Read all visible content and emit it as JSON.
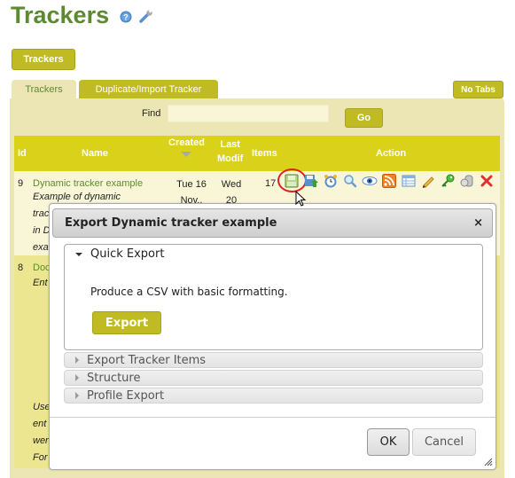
{
  "page": {
    "title": "Trackers",
    "help_icon": "help-icon",
    "admin_icon": "wrench-icon"
  },
  "toolbar": {
    "trackers_button": "Trackers",
    "no_tabs_button": "No Tabs"
  },
  "tabs": [
    {
      "label": "Trackers",
      "active": true
    },
    {
      "label": "Duplicate/Import Tracker",
      "active": false
    }
  ],
  "find": {
    "label": "Find",
    "value": "",
    "go_label": "Go"
  },
  "table": {
    "columns": [
      "Id",
      "Name",
      "Created",
      "Last Modif",
      "Items",
      "Action"
    ],
    "created_col": {
      "line1": "Created"
    },
    "lastmodif_col": {
      "line1": "Last",
      "line2": "Modif"
    },
    "rows": [
      {
        "id": "9",
        "name": "Dynamic tracker example",
        "description_lines": [
          "Example of dynamic",
          "trac",
          "in D",
          "exa"
        ],
        "created": {
          "line1": "Tue 16",
          "line2": "Nov.,"
        },
        "last_modif": {
          "line1": "Wed",
          "line2": "20"
        },
        "items": "17",
        "actions": [
          "export-icon",
          "import-icon",
          "clock-icon",
          "search-icon",
          "eye-icon",
          "rss-icon",
          "table-icon",
          "pencil-icon",
          "key-icon",
          "trash-icon",
          "delete-icon"
        ]
      },
      {
        "id": "8",
        "name": "Doc",
        "description_lines": [
          "Ent"
        ],
        "description_lines_bottom": [
          "Use",
          "ent",
          "wer",
          "For"
        ]
      }
    ]
  },
  "dialog": {
    "title": "Export Dynamic tracker example",
    "close_label": "×",
    "sections": [
      {
        "label": "Quick Export",
        "expanded": true,
        "description": "Produce a CSV with basic formatting.",
        "button": "Export"
      },
      {
        "label": "Export Tracker Items",
        "expanded": false
      },
      {
        "label": "Structure",
        "expanded": false
      },
      {
        "label": "Profile Export",
        "expanded": false
      }
    ],
    "ok_label": "OK",
    "cancel_label": "Cancel"
  },
  "colors": {
    "title_green": "#5d8a31",
    "olive_button": "#c0bb23",
    "header_yellow": "#dad21a",
    "panel_bg": "#ece6b4",
    "row_light": "#f8f6d6",
    "row_alt": "#ede690",
    "highlight_ring": "#e02020"
  }
}
